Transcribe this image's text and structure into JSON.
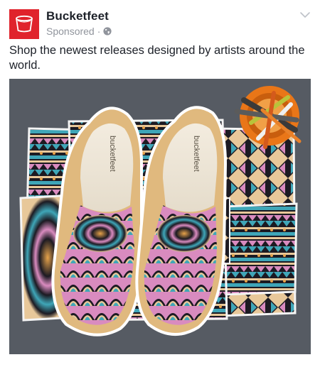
{
  "post": {
    "page_name": "Bucketfeet",
    "sponsored_label": "Sponsored",
    "separator": "·",
    "caption": "Shop the newest releases designed by artists around the world.",
    "shoe_brand_left": "bucketfeet",
    "shoe_brand_right": "bucketfeet"
  },
  "colors": {
    "brand_red": "#e0232c",
    "text": "#1d2129",
    "muted": "#90949c",
    "background_gray": "#565b63"
  },
  "icons": {
    "avatar": "bucketfeet-logo-icon",
    "privacy": "globe-icon",
    "menu": "chevron-down-icon"
  }
}
